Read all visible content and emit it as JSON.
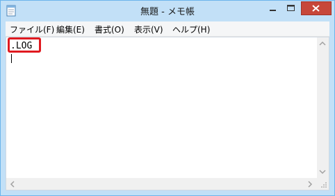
{
  "window": {
    "title": "無題 - メモ帳",
    "icon": "notepad-icon",
    "accent": "#6bb4ec",
    "close_color": "#c7473a"
  },
  "menu": {
    "items": [
      {
        "label": "ファイル(F)"
      },
      {
        "label": "編集(E)"
      },
      {
        "label": "書式(O)"
      },
      {
        "label": "表示(V)"
      },
      {
        "label": "ヘルプ(H)"
      }
    ]
  },
  "editor": {
    "text": ".LOG",
    "highlight_color": "#e0191f"
  }
}
